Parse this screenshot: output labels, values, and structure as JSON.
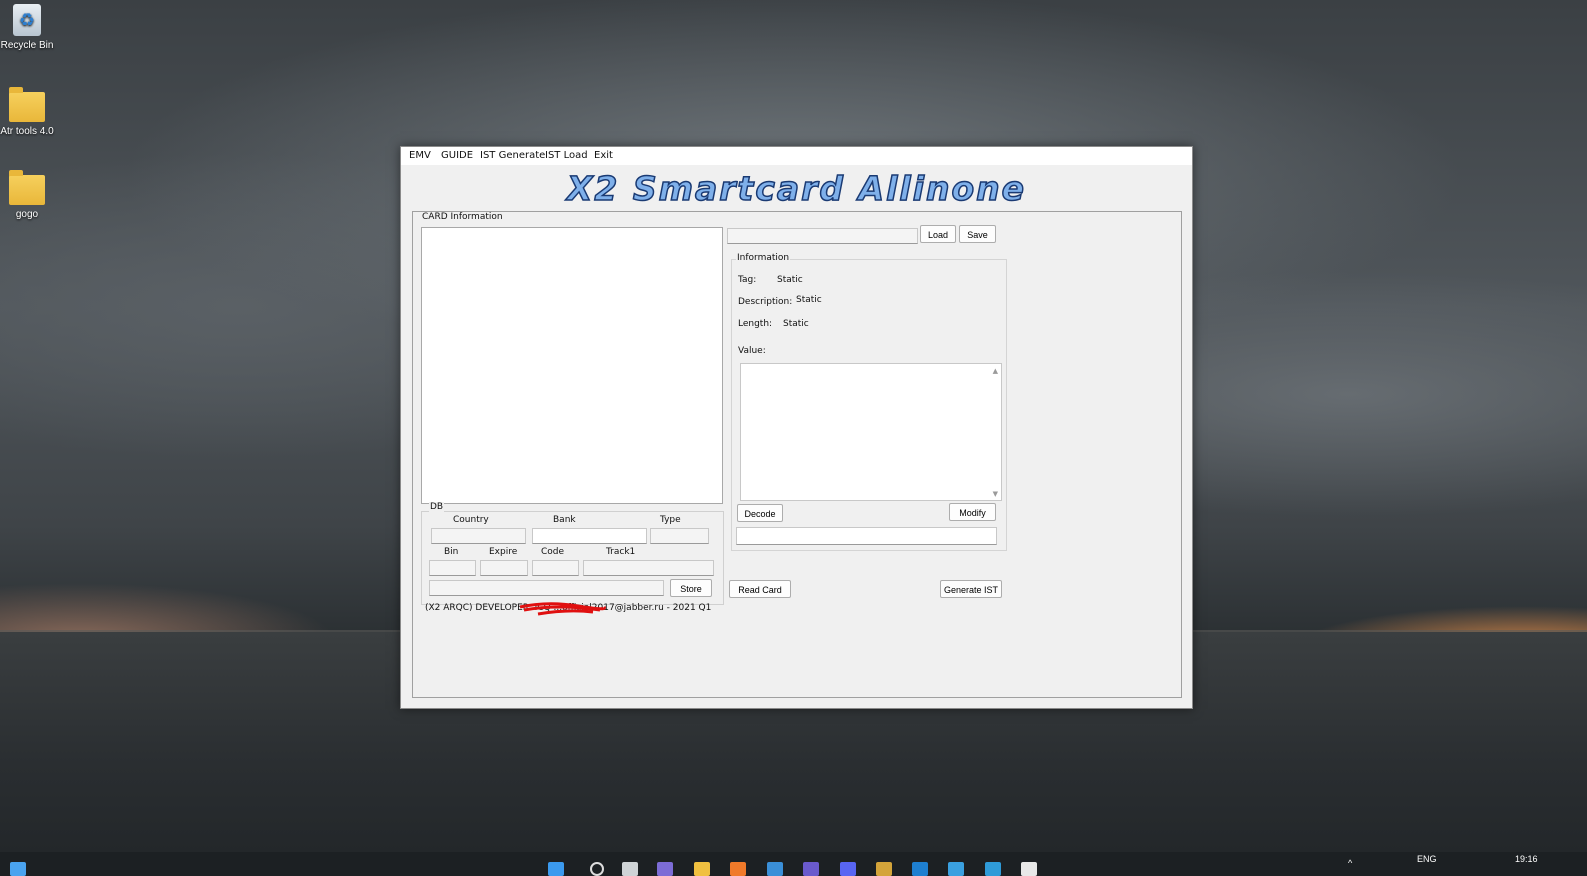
{
  "desktop": {
    "icons": [
      {
        "label": "Recycle Bin"
      },
      {
        "label": "Atr tools 4.0"
      },
      {
        "label": "gogo"
      }
    ]
  },
  "app": {
    "menu": [
      "EMV",
      "GUIDE",
      "IST Generate",
      "IST Load",
      "Exit"
    ],
    "title": "X2 Smartcard Allinone",
    "card_group_label": "CARD Information",
    "db": {
      "group_label": "DB",
      "country_label": "Country",
      "bank_label": "Bank",
      "type_label": "Type",
      "bin_label": "Bin",
      "expire_label": "Expire",
      "code_label": "Code",
      "track1_label": "Track1",
      "store_button": "Store"
    },
    "load_button": "Load",
    "save_button": "Save",
    "information": {
      "group_label": "Information",
      "tag_label": "Tag:",
      "tag_value": "Static",
      "description_label": "Description:",
      "description_value": "Static",
      "length_label": "Length:",
      "length_value": "Static",
      "value_label": "Value:"
    },
    "decode_button": "Decode",
    "modify_button": "Modify",
    "read_card_button": "Read Card",
    "generate_ist_button": "Generate IST",
    "footer": "(X2 ARQC) DEVELOPER: ICQ ...official2017@jabber.ru - 2021 Q1"
  },
  "taskbar": {
    "language": "ENG",
    "time": "19:16"
  }
}
